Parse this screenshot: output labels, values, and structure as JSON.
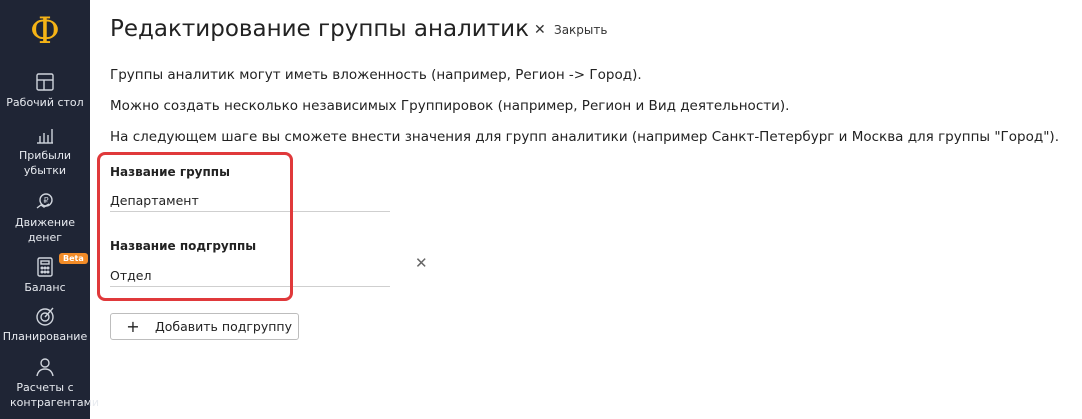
{
  "sidebar": {
    "logo": "Ф",
    "items": [
      {
        "label": "Рабочий стол",
        "icon": "dashboard-icon"
      },
      {
        "label": "Прибыли убытки",
        "icon": "bar-chart-icon"
      },
      {
        "label": "Движение денег",
        "icon": "money-flow-icon"
      },
      {
        "label": "Баланс",
        "icon": "calculator-icon",
        "badge": "Beta"
      },
      {
        "label": "Планирование",
        "icon": "target-icon"
      },
      {
        "label": "Расчеты с контрагентами",
        "icon": "people-icon"
      }
    ]
  },
  "header": {
    "title": "Редактирование группы аналитик",
    "close_label": "Закрыть"
  },
  "description": [
    "Группы аналитик могут иметь вложенность (например, Регион -> Город).",
    "Можно создать несколько независимых Группировок (например, Регион и Вид деятельности).",
    "На следующем шаге вы сможете внести значения для групп аналитики (например Санкт-Петербург и Москва для группы \"Город\")."
  ],
  "form": {
    "group_label": "Название группы",
    "group_value": "Департамент",
    "subgroup_label": "Название подгруппы",
    "subgroup_value": "Отдел",
    "add_subgroup_label": "Добавить подгруппу"
  },
  "colors": {
    "accent": "#f5b316",
    "sidebar": "#1f2535",
    "highlight": "#e0393b",
    "badge": "#f28c28"
  }
}
